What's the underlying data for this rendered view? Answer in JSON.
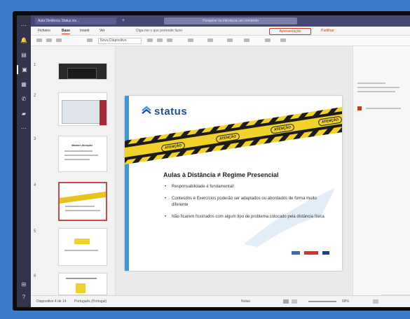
{
  "window": {
    "tab_title": "Aula Distância Status sis...",
    "search_placeholder": "Pesquise ou introduza um comando"
  },
  "ribbon": {
    "tabs": [
      "Ficheiro",
      "Base",
      "Inserir",
      "Ver"
    ],
    "tell_me": "Diga-me o que pretende fazer",
    "present_label": "Apresentação",
    "share_label": "Partilhar"
  },
  "toolbar": {
    "font_name": "Nova Diapositivo"
  },
  "thumbnails": [
    {
      "num": "1"
    },
    {
      "num": "2"
    },
    {
      "num": "3",
      "title": "Manter Atenção"
    },
    {
      "num": "4"
    },
    {
      "num": "5"
    },
    {
      "num": "6"
    }
  ],
  "slide": {
    "logo": "status",
    "caution_text": "ATENÇÃO",
    "title": "Aulas à Distância ≠ Regime Presencial",
    "bullets": [
      "Responsabilidade é fundamental!",
      "Conteúdos e Exercícios poderão ser adaptados ou abordados de forma muito diferente",
      "Não ficarem frustrados com algum tipo de problema colocado pela distância física"
    ]
  },
  "status": {
    "slide_info": "Diapositivo 4 de 14",
    "language": "Português (Portugal)",
    "notes": "Notas",
    "zoom": "68%"
  },
  "colors": {
    "rail": "#33344a",
    "titlebar": "#464775",
    "accent": "#c43e1c",
    "slide_bar": "#3f97d7",
    "caution_yellow": "#f0d22a"
  }
}
